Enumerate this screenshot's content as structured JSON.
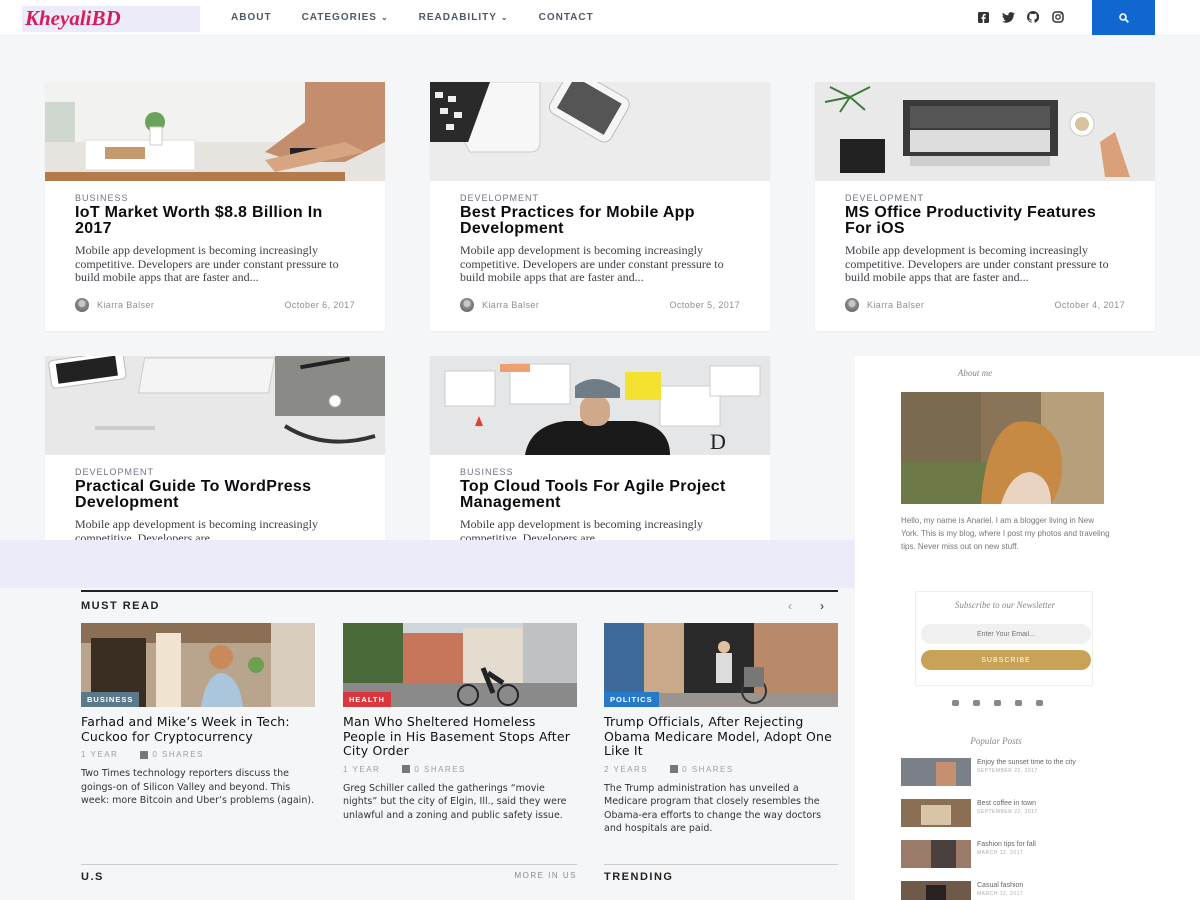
{
  "header": {
    "logo": "KheyaliBD",
    "nav": [
      {
        "label": "ABOUT",
        "dropdown": false
      },
      {
        "label": "CATEGORIES",
        "dropdown": true
      },
      {
        "label": "READABILITY",
        "dropdown": true
      },
      {
        "label": "CONTACT",
        "dropdown": false
      }
    ],
    "social_icons": [
      "facebook-icon",
      "twitter-icon",
      "github-icon",
      "instagram-icon"
    ],
    "search_icon": "search-icon",
    "accent": "#1167cf",
    "logo_color": "#d81b5a"
  },
  "cards": [
    {
      "category": "BUSINESS",
      "title": "IoT Market Worth $8.8 Billion In 2017",
      "excerpt": "Mobile app development is becoming increasingly competitive. Developers are under constant pressure to build mobile apps that are faster and...",
      "author": "Kiarra Balser",
      "date": "October 6, 2017"
    },
    {
      "category": "DEVELOPMENT",
      "title": "Best Practices for Mobile App Development",
      "excerpt": "Mobile app development is becoming increasingly competitive. Developers are under constant pressure to build mobile apps that are faster and...",
      "author": "Kiarra Balser",
      "date": "October 5, 2017"
    },
    {
      "category": "DEVELOPMENT",
      "title": "MS Office Productivity Features For iOS",
      "excerpt": "Mobile app development is becoming increasingly competitive. Developers are under constant pressure to build mobile apps that are faster and...",
      "author": "Kiarra Balser",
      "date": "October 4, 2017"
    },
    {
      "category": "DEVELOPMENT",
      "title": "Practical Guide To WordPress Development",
      "excerpt": "Mobile app development is becoming increasingly competitive. Developers are"
    },
    {
      "category": "BUSINESS",
      "title": "Top Cloud Tools For Agile Project Management",
      "excerpt": "Mobile app development is becoming increasingly competitive. Developers are"
    }
  ],
  "must_read": {
    "title": "MUST READ",
    "prev": "‹",
    "next": "›",
    "items": [
      {
        "badge": "BUSINESS",
        "badge_color": "#5a7a8c",
        "title": "Farhad and Mike’s Week in Tech: Cuckoo for Cryptocurrency",
        "age": "1 YEAR",
        "shares": "0 SHARES",
        "excerpt": "Two Times technology reporters discuss the goings-on of Silicon Valley and beyond. This week: more Bitcoin and Uber’s problems (again)."
      },
      {
        "badge": "HEALTH",
        "badge_color": "#d9363e",
        "title": "Man Who Sheltered Homeless People in His Basement Stops After City Order",
        "age": "1 YEAR",
        "shares": "0 SHARES",
        "excerpt": "Greg Schiller called the gatherings “movie nights” but the city of Elgin, Ill., said they were unlawful and a zoning and public safety issue."
      },
      {
        "badge": "POLITICS",
        "badge_color": "#2779c9",
        "title": "Trump Officials, After Rejecting Obama Medicare Model, Adopt One Like It",
        "age": "2 YEARS",
        "shares": "0 SHARES",
        "excerpt": "The Trump administration has unveiled a Medicare program that closely resembles the Obama-era efforts to change the way doctors and hospitals are paid."
      }
    ]
  },
  "bottom": {
    "us": "U.S",
    "more": "MORE IN US",
    "trending": "TRENDING"
  },
  "sidebar": {
    "about_head": "About me",
    "about_text": "Hello, my name is Anariel. I am a blogger living in New York. This is my blog, where I post my photos and traveling tips. Never miss out on new stuff.",
    "newsletter_head": "Subscribe to our Newsletter",
    "newsletter_placeholder": "Enter Your Email...",
    "newsletter_button": "SUBSCRIBE",
    "popular_head": "Popular Posts",
    "popular": [
      {
        "title": "Enjoy the sunset time to the city",
        "date": "SEPTEMBER 22, 2017"
      },
      {
        "title": "Best coffee in town",
        "date": "SEPTEMBER 22, 2017"
      },
      {
        "title": "Fashion tips for fall",
        "date": "MARCH 12, 2017"
      },
      {
        "title": "Casual fashion",
        "date": "MARCH 12, 2017"
      }
    ]
  }
}
